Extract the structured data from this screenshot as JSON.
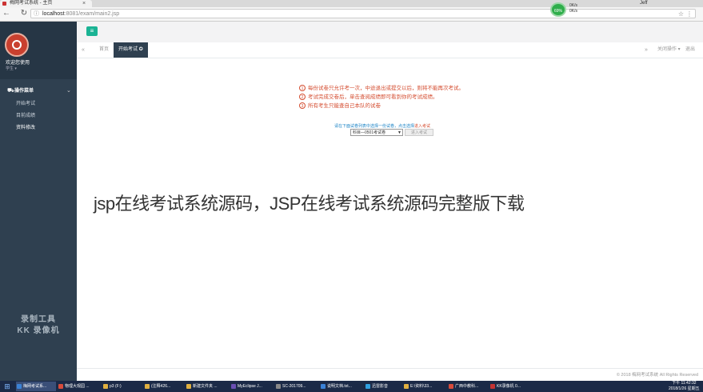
{
  "browser": {
    "tab_title": "梅网考试系统 - 主页",
    "tab_close": "×",
    "url_host": "localhost",
    "url_rest": ":8081/exam/main2.jsp",
    "window_user": "Jeff",
    "speed_widget": {
      "percent": "69%",
      "up": "0K/s",
      "down": "0K/s"
    }
  },
  "sidebar": {
    "welcome": "欢迎您使用",
    "role": "学生 ▾",
    "group_label": "操作菜单",
    "items": [
      {
        "label": "开始考试"
      },
      {
        "label": "目前成绩"
      },
      {
        "label": "资料修改"
      }
    ],
    "recorder_watermark": [
      "录制工具",
      "KK 录像机"
    ]
  },
  "tabs": {
    "home": "首页",
    "active": "开始考试 ✪",
    "ops": "关闭操作 ▾",
    "exit": "退出"
  },
  "notices": [
    {
      "num": "1",
      "text": "每份试卷只允许考一次，中途退出或提交以后，则将不能再次考试。"
    },
    {
      "num": "2",
      "text": "考试完成交卷后，单击查阅成绩即可看到你的考试成绩。"
    },
    {
      "num": "3",
      "text": "所有考生只能查自己本队的试卷"
    }
  ],
  "select_hint_pre": "请在下面试卷列表中选择一份试卷，点击选择",
  "select_hint_hl": "进入考试",
  "exam_select": {
    "selected": "科目—0501考试卷"
  },
  "enter_button": "进入考试",
  "overlay_title": "jsp在线考试系统源码，JSP在线考试系统源码完整版下载",
  "footer": "© 2018 梅网考试系统 All Rights Reserved",
  "taskbar": {
    "tasks": [
      {
        "label": "梅网考试系...",
        "color": "#3b82d6"
      },
      {
        "label": "物理大观园 ...",
        "color": "#d64b3b"
      },
      {
        "label": "p3 (F:)",
        "color": "#e0b040"
      },
      {
        "label": "(注释426...",
        "color": "#e0b040"
      },
      {
        "label": "新建文件夹 ...",
        "color": "#e0b040"
      },
      {
        "label": "MyEclipse J...",
        "color": "#6a4fb3"
      },
      {
        "label": "SC-201709...",
        "color": "#888888"
      },
      {
        "label": "说明文档.txt...",
        "color": "#3b82d6"
      },
      {
        "label": "迅雷影音",
        "color": "#2fa0e0"
      },
      {
        "label": "E:\\资料\\33...",
        "color": "#e0b040"
      },
      {
        "label": "广西中教科...",
        "color": "#d64b3b"
      },
      {
        "label": "KK录像机 0...",
        "color": "#c33333"
      }
    ],
    "clock_time": "下午 11:42:32",
    "clock_date": "2018/1/26 星期五"
  }
}
